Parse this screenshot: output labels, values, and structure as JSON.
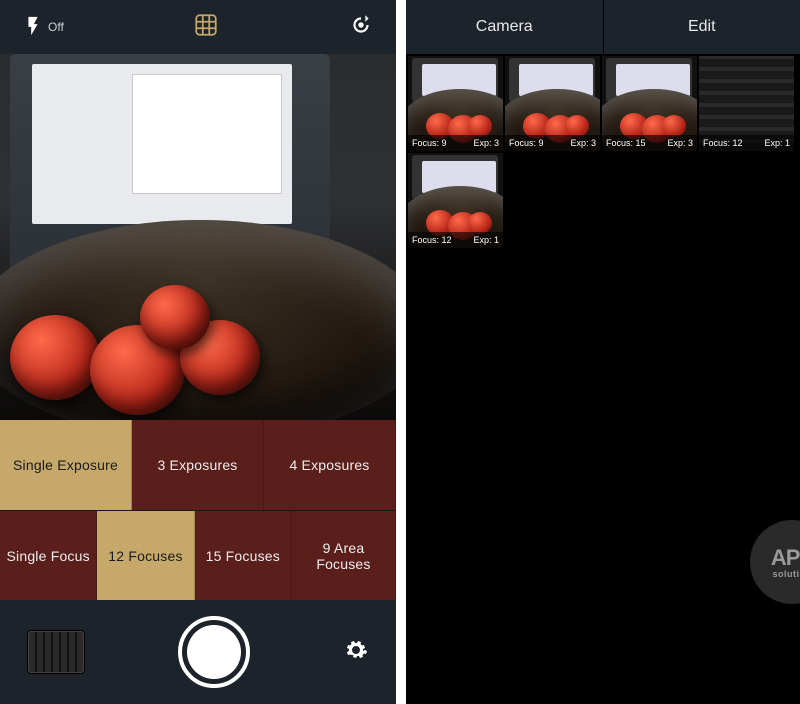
{
  "left": {
    "flash_label": "Off",
    "exposure_options": [
      "Single Exposure",
      "3 Exposures",
      "4 Exposures"
    ],
    "exposure_selected_index": 0,
    "focus_options": [
      "Single Focus",
      "12 Focuses",
      "15 Focuses",
      "9 Area Focuses"
    ],
    "focus_selected_index": 1
  },
  "right": {
    "tabs": [
      "Camera",
      "Edit"
    ],
    "thumbs": [
      {
        "focus": "Focus: 9",
        "exp": "Exp: 3",
        "variant": "normal"
      },
      {
        "focus": "Focus: 9",
        "exp": "Exp: 3",
        "variant": "normal"
      },
      {
        "focus": "Focus: 15",
        "exp": "Exp: 3",
        "variant": "normal"
      },
      {
        "focus": "Focus: 12",
        "exp": "Exp: 1",
        "variant": "keyboard"
      },
      {
        "focus": "Focus: 12",
        "exp": "Exp: 1",
        "variant": "normal"
      }
    ]
  },
  "watermark": {
    "top": "APP",
    "bottom": "solution"
  }
}
